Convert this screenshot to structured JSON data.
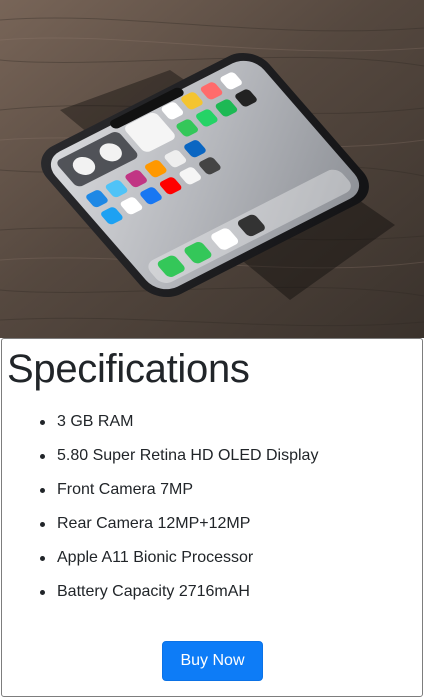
{
  "product_image": {
    "icon": "smartphone-photo"
  },
  "card": {
    "title": "Specifications",
    "specs": [
      "3 GB RAM",
      "5.80 Super Retina HD OLED Display",
      "Front Camera 7MP",
      "Rear Camera 12MP+12MP",
      "Apple A11 Bionic Processor",
      "Battery Capacity 2716mAH"
    ],
    "buy_label": "Buy Now"
  },
  "colors": {
    "accent": "#0d7cf7",
    "text": "#212529",
    "border": "#7d7d7d"
  }
}
